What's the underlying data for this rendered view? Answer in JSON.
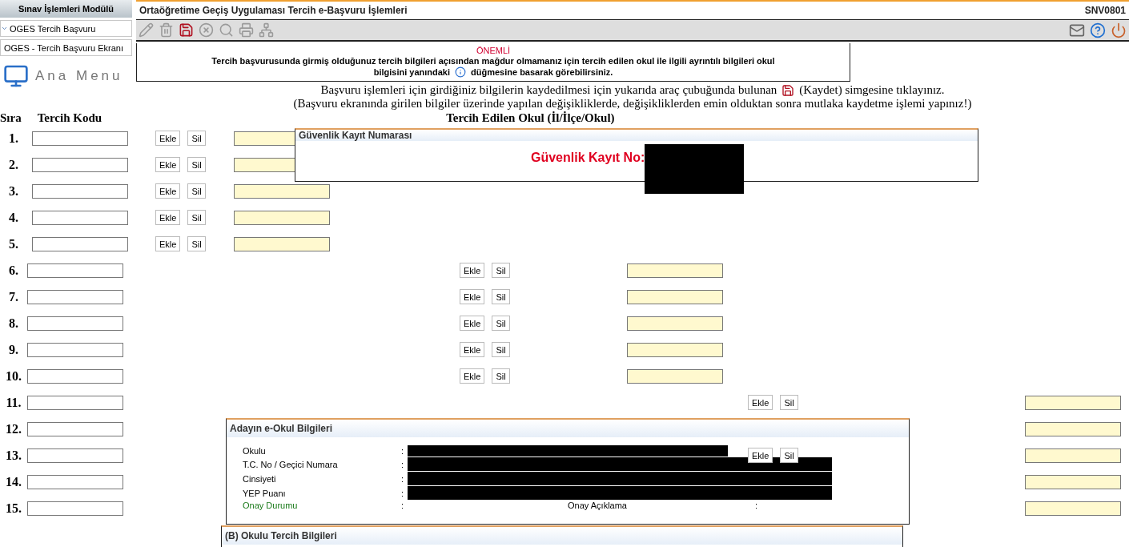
{
  "sidebar": {
    "title": "Sınav İşlemleri Modülü",
    "items": [
      {
        "label": "OGES Tercih Başvuru",
        "kind": "group",
        "expanded": true
      },
      {
        "label": "OGES - Tercih Başvuru Ekranı",
        "kind": "page"
      }
    ],
    "home_label": "Ana Menu"
  },
  "window": {
    "title": "Ortaöğretime Geçiş Uygulaması Tercih e-Başvuru İşlemleri",
    "code": "SNV0801"
  },
  "toolbar": {
    "left": [
      {
        "kind": "edit",
        "disabled": true
      },
      {
        "kind": "delete",
        "disabled": true
      },
      {
        "kind": "save",
        "disabled": false
      },
      {
        "kind": "cancel",
        "disabled": true
      },
      {
        "kind": "search",
        "disabled": true
      },
      {
        "kind": "print",
        "disabled": true
      },
      {
        "kind": "network",
        "disabled": true
      }
    ],
    "right": [
      {
        "kind": "mail"
      },
      {
        "kind": "help"
      },
      {
        "kind": "exit"
      }
    ]
  },
  "notice": {
    "heading": "ÖNEMLİ",
    "line_1": "Tercih başvurusunda girmiş olduğunuz tercih bilgileri açısından mağdur olmamanız için tercih edilen okul ile ilgili ayrıntılı bilgileri okul",
    "line_2_start": "bilgisini yanındaki",
    "line_2_end": "düğmesine basarak görebilirsiniz."
  },
  "instructions": {
    "line_1_start": "Başvuru işlemleri için girdiğiniz bilgilerin kaydedilmesi için yukarıda araç çubuğunda bulunan",
    "line_1_end": "(Kaydet) simgesine tıklayınız.",
    "line_2": "(Başvuru ekranında girilen bilgiler üzerinde yapılan değişikliklerde, değişikliklerden emin olduktan sonra mutlaka kaydetme işlemi yapınız!)"
  },
  "table": {
    "columns": [
      "Sıra",
      "Tercih Kodu",
      "Tercih Edilen Okul  (İl/İlçe/Okul)"
    ],
    "rows": [
      {
        "number": "1.",
        "actions": [
          "Ekle",
          "Sil"
        ]
      },
      {
        "number": "2.",
        "actions": [
          "Ekle",
          "Sil"
        ]
      },
      {
        "number": "3.",
        "actions": [
          "Ekle",
          "Sil"
        ]
      },
      {
        "number": "4.",
        "actions": [
          "Ekle",
          "Sil"
        ]
      },
      {
        "number": "5.",
        "actions": [
          "Ekle",
          "Sil"
        ]
      },
      {
        "number": "6.",
        "actions": [
          "Ekle",
          "Sil"
        ]
      },
      {
        "number": "7.",
        "actions": [
          "Ekle",
          "Sil"
        ]
      },
      {
        "number": "8.",
        "actions": [
          "Ekle",
          "Sil"
        ]
      },
      {
        "number": "9.",
        "actions": [
          "Ekle",
          "Sil"
        ]
      },
      {
        "number": "10.",
        "actions": [
          "Ekle",
          "Sil"
        ]
      },
      {
        "number": "11.",
        "actions": [
          "Ekle",
          "Sil"
        ]
      },
      {
        "number": "12."
      },
      {
        "number": "13.",
        "actions": [
          "Ekle",
          "Sil"
        ]
      },
      {
        "number": "14."
      },
      {
        "number": "15."
      }
    ]
  },
  "security_panel": {
    "title": "Güvenlik Kayıt Numarası",
    "label": "Güvenlik Kayıt No:"
  },
  "eokul_panel": {
    "title": "Adayın e-Okul Bilgileri",
    "fields": [
      {
        "label": "Okulu",
        "separator": ":",
        "redacted": true
      },
      {
        "label": "T.C. No / Geçici Numara",
        "separator": ":",
        "redacted": true
      },
      {
        "label": "Cinsiyeti",
        "separator": ":",
        "redacted": true
      },
      {
        "label": "YEP Puanı",
        "separator": ":",
        "redacted": true
      },
      {
        "label": "Onay Durumu",
        "kind": "status",
        "separator": ":",
        "redacted": false,
        "extra_label": "Onay Açıklama",
        "extra_separator": ":"
      }
    ]
  },
  "section_b": {
    "title": "(B) Okulu Tercih Bilgileri"
  }
}
